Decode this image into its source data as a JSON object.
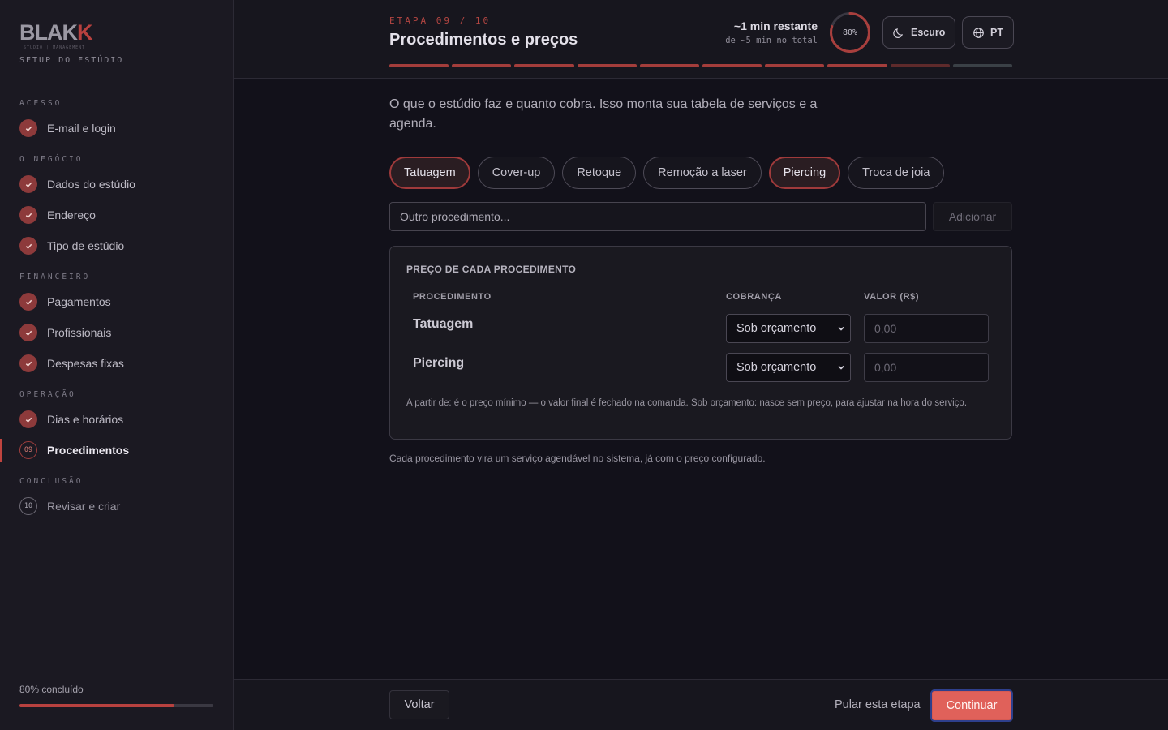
{
  "brand": {
    "logo_text_a": "BLAK",
    "logo_text_b": "K",
    "logo_sub": "STUDIO | MANAGEMENT",
    "setup_label": "SETUP DO ESTÚDIO"
  },
  "sidebar": {
    "sections": {
      "acesso": "ACESSO",
      "negocio": "O NEGÓCIO",
      "financeiro": "FINANCEIRO",
      "operacao": "OPERAÇÃO",
      "conclusao": "CONCLUSÃO"
    },
    "items": [
      {
        "label": "E-mail e login",
        "status": "done"
      },
      {
        "label": "Dados do estúdio",
        "status": "done"
      },
      {
        "label": "Endereço",
        "status": "done"
      },
      {
        "label": "Tipo de estúdio",
        "status": "done"
      },
      {
        "label": "Pagamentos",
        "status": "done"
      },
      {
        "label": "Profissionais",
        "status": "done"
      },
      {
        "label": "Despesas fixas",
        "status": "done"
      },
      {
        "label": "Dias e horários",
        "status": "done"
      },
      {
        "label": "Procedimentos",
        "status": "active",
        "number": "09"
      },
      {
        "label": "Revisar e criar",
        "status": "pending",
        "number": "10"
      }
    ],
    "progress_label": "80% concluído",
    "progress_fraction": 0.8
  },
  "header": {
    "step_label": "ETAPA 09 / 10",
    "title": "Procedimentos e preços",
    "time_remaining": "~1 min restante",
    "time_total": "de ~5 min no total",
    "progress_percent_label": "80%",
    "progress_fraction": 0.8,
    "theme_button": "Escuro",
    "lang_button": "PT",
    "steps_done": 8,
    "steps_total": 10
  },
  "main": {
    "intro": "O que o estúdio faz e quanto cobra. Isso monta sua tabela de serviços e a agenda.",
    "chips": [
      {
        "label": "Tatuagem",
        "selected": true
      },
      {
        "label": "Cover-up",
        "selected": false
      },
      {
        "label": "Retoque",
        "selected": false
      },
      {
        "label": "Remoção a laser",
        "selected": false
      },
      {
        "label": "Piercing",
        "selected": true
      },
      {
        "label": "Troca de joia",
        "selected": false
      }
    ],
    "other_placeholder": "Outro procedimento...",
    "add_button": "Adicionar",
    "price_card": {
      "title": "PREÇO DE CADA PROCEDIMENTO",
      "col_procedure": "PROCEDIMENTO",
      "col_charge": "COBRANÇA",
      "col_value": "VALOR (R$)",
      "rows": [
        {
          "name": "Tatuagem",
          "charge": "Sob orçamento",
          "value_placeholder": "0,00"
        },
        {
          "name": "Piercing",
          "charge": "Sob orçamento",
          "value_placeholder": "0,00"
        }
      ],
      "note": "A partir de: é o preço mínimo — o valor final é fechado na comanda. Sob orçamento: nasce sem preço, para ajustar na hora do serviço."
    },
    "footnote": "Cada procedimento vira um serviço agendável no sistema, já com o preço configurado."
  },
  "footer": {
    "back": "Voltar",
    "skip": "Pular esta etapa",
    "continue": "Continuar"
  },
  "colors": {
    "accent": "#b8413f",
    "primary_button": "#e0615a",
    "background": "#12111a",
    "sidebar": "#1b1922"
  }
}
